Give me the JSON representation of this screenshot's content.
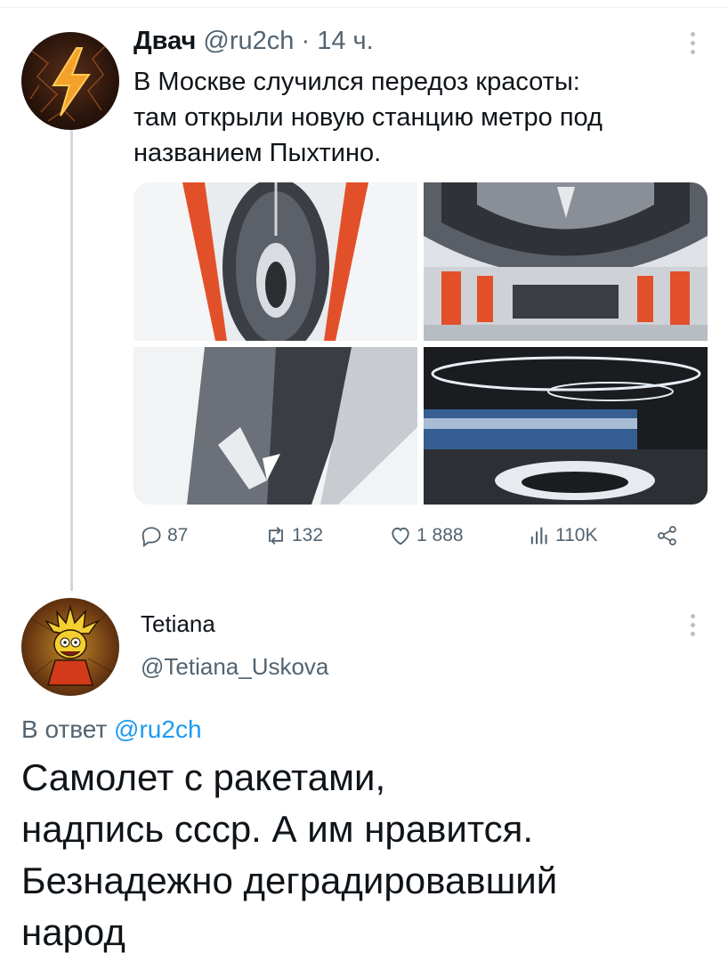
{
  "tweet": {
    "author_name": "Двач",
    "author_handle": "@ru2ch",
    "separator": "·",
    "time": "14 ч.",
    "text_lines": [
      "В Москве случился передоз красоты:",
      "там открыли новую станцию метро под",
      "названием Пыхтино."
    ],
    "stats": {
      "replies": "87",
      "retweets": "132",
      "likes": "1 888",
      "views": "110K"
    },
    "icons": [
      "lightning-avatar",
      "more-icon",
      "reply-icon",
      "retweet-icon",
      "like-icon",
      "views-icon",
      "share-icon"
    ]
  },
  "reply": {
    "author_name": "Tetiana",
    "author_handle": "@Tetiana_Uskova",
    "reply_to_prefix": "В ответ",
    "reply_to_mention": "@ru2ch",
    "text_lines": [
      "Самолет с ракетами,",
      "надпись ссср. А им нравится.",
      "Безнадежно деградировавший",
      "народ"
    ]
  },
  "colors": {
    "text": "#0f1419",
    "secondary": "#536471",
    "link": "#1d9bf0",
    "thread_line": "#cfd9de",
    "metro_accent": "#e2502a"
  }
}
